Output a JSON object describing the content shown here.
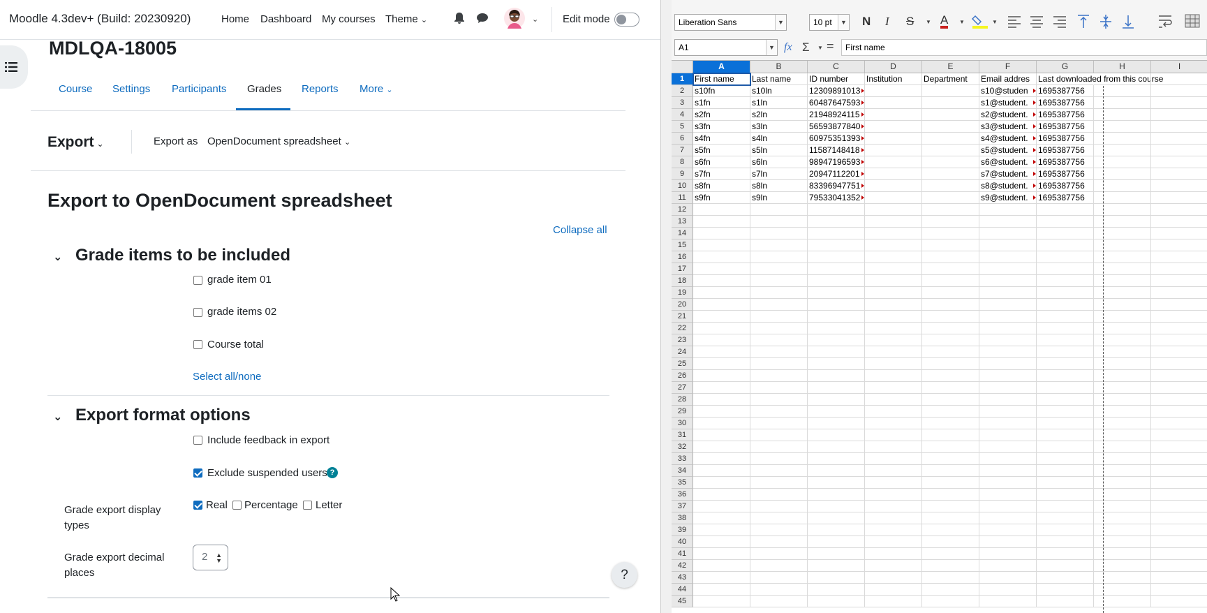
{
  "moodle": {
    "site_title": "Moodle 4.3dev+ (Build: 20230920)",
    "primary_nav": [
      "Home",
      "Dashboard",
      "My courses",
      "Theme"
    ],
    "edit_mode_label": "Edit mode",
    "course_title": "MDLQA-18005",
    "course_tabs": [
      "Course",
      "Settings",
      "Participants",
      "Grades",
      "Reports",
      "More"
    ],
    "active_tab": "Grades",
    "tertiary": {
      "export_dropdown": "Export",
      "export_as_label": "Export as",
      "export_as_value": "OpenDocument spreadsheet"
    },
    "page_heading": "Export to OpenDocument spreadsheet",
    "collapse_all": "Collapse all",
    "grade_items_section": {
      "title": "Grade items to be included",
      "items": [
        {
          "label": "grade item 01",
          "checked": false
        },
        {
          "label": "grade items 02",
          "checked": false
        },
        {
          "label": "Course total",
          "checked": false
        }
      ],
      "select_all": "Select all/none"
    },
    "format_section": {
      "title": "Export format options",
      "include_feedback": {
        "label": "Include feedback in export",
        "checked": false
      },
      "exclude_suspended": {
        "label": "Exclude suspended users",
        "checked": true
      },
      "display_types_label": "Grade export display types",
      "display_types": [
        {
          "label": "Real",
          "checked": true
        },
        {
          "label": "Percentage",
          "checked": false
        },
        {
          "label": "Letter",
          "checked": false
        }
      ],
      "decimal_label": "Grade export decimal places",
      "decimal_value": "2"
    },
    "help_icon": "question-circle-icon",
    "help_fab": "?"
  },
  "calc": {
    "font_name": "Liberation Sans",
    "font_size": "10 pt",
    "name_box": "A1",
    "formula": "First name",
    "bold_glyph": "N",
    "italic_glyph": "I",
    "strike_glyph": "S",
    "font_color_glyph": "A",
    "columns": [
      "A",
      "B",
      "C",
      "D",
      "E",
      "F",
      "G",
      "H",
      "I"
    ],
    "row_numbers": [
      "1",
      "2",
      "3",
      "4",
      "5",
      "6",
      "7",
      "8",
      "9",
      "10",
      "11",
      "12",
      "13",
      "14",
      "15",
      "16",
      "17",
      "18",
      "19",
      "20",
      "21",
      "22",
      "23",
      "24",
      "25",
      "26",
      "27",
      "28",
      "29",
      "30",
      "31",
      "32",
      "33",
      "34",
      "35",
      "36",
      "37",
      "38",
      "39",
      "40",
      "41",
      "42",
      "43",
      "44",
      "45"
    ],
    "header_row": [
      "First name",
      "Last name",
      "ID number",
      "Institution",
      "Department",
      "Email addres",
      "Last downloaded from this course"
    ],
    "rows": [
      [
        "s10fn",
        "s10ln",
        "12309891013",
        "",
        "",
        "s10@studen",
        "1695387756"
      ],
      [
        "s1fn",
        "s1ln",
        "60487647593",
        "",
        "",
        "s1@student.",
        "1695387756"
      ],
      [
        "s2fn",
        "s2ln",
        "21948924115",
        "",
        "",
        "s2@student.",
        "1695387756"
      ],
      [
        "s3fn",
        "s3ln",
        "56593877840",
        "",
        "",
        "s3@student.",
        "1695387756"
      ],
      [
        "s4fn",
        "s4ln",
        "60975351393",
        "",
        "",
        "s4@student.",
        "1695387756"
      ],
      [
        "s5fn",
        "s5ln",
        "11587148418",
        "",
        "",
        "s5@student.",
        "1695387756"
      ],
      [
        "s6fn",
        "s6ln",
        "98947196593",
        "",
        "",
        "s6@student.",
        "1695387756"
      ],
      [
        "s7fn",
        "s7ln",
        "20947112201",
        "",
        "",
        "s7@student.",
        "1695387756"
      ],
      [
        "s8fn",
        "s8ln",
        "83396947751",
        "",
        "",
        "s8@student.",
        "1695387756"
      ],
      [
        "s9fn",
        "s9ln",
        "79533041352",
        "",
        "",
        "s9@student.",
        "1695387756"
      ]
    ]
  },
  "colors": {
    "moodle_link": "#0f6cbf",
    "calc_selection": "#0a70d8",
    "help_icon": "#008196"
  }
}
